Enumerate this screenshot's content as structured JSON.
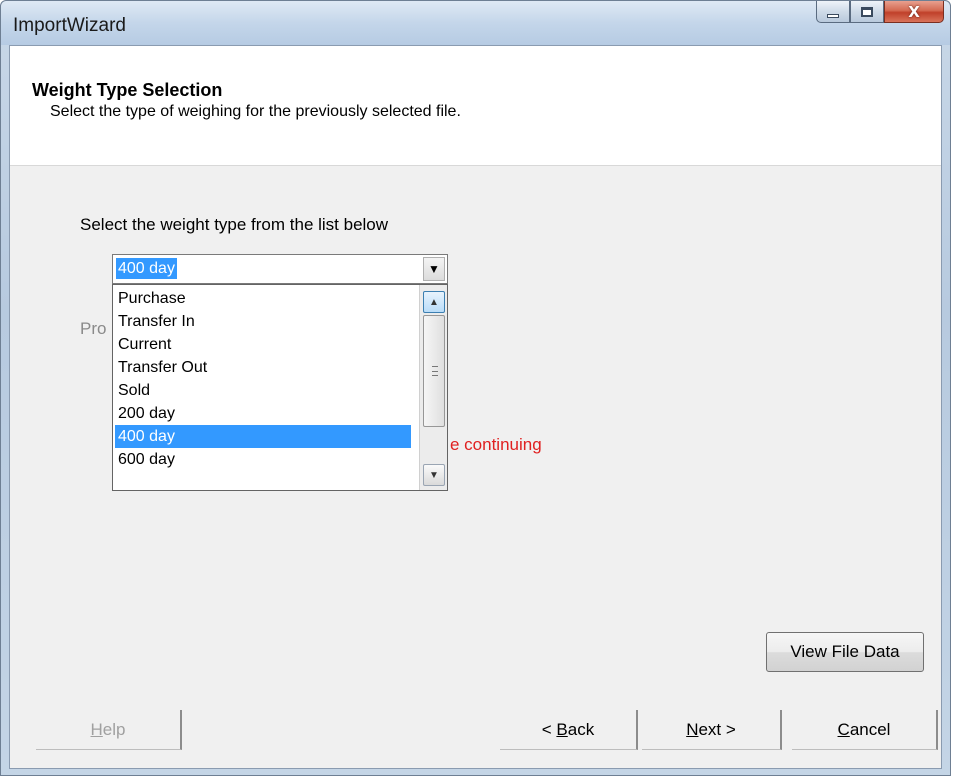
{
  "window": {
    "title": "ImportWizard",
    "minimize_icon": "minimize-icon",
    "maximize_icon": "maximize-icon",
    "close_icon": "close-icon",
    "close_glyph": "X"
  },
  "header": {
    "title": "Weight Type Selection",
    "subtitle": "Select the type of weighing for the previously selected file."
  },
  "form": {
    "prompt": "Select the weight type from the list below",
    "obscured_label": "Pro",
    "obscured_warning": "e continuing"
  },
  "weight_type": {
    "selected": "400 day",
    "arrow_icon": "chevron-down-icon",
    "options": [
      {
        "label": "Purchase",
        "selected": false
      },
      {
        "label": "Transfer In",
        "selected": false
      },
      {
        "label": "Current",
        "selected": false
      },
      {
        "label": "Transfer Out",
        "selected": false
      },
      {
        "label": "Sold",
        "selected": false
      },
      {
        "label": "200 day",
        "selected": false
      },
      {
        "label": "400 day",
        "selected": true
      },
      {
        "label": "600 day",
        "selected": false
      }
    ]
  },
  "buttons": {
    "view_file_data": "View File Data",
    "help_mnemonic": "H",
    "help_rest": "elp",
    "back_prefix": "< ",
    "back_mnemonic": "B",
    "back_rest": "ack",
    "next_mnemonic": "N",
    "next_rest": "ext >",
    "cancel_mnemonic": "C",
    "cancel_rest": "ancel"
  },
  "colors": {
    "selection": "#3399ff",
    "warning_text": "#e02020",
    "client_bg": "#f0f0f0"
  }
}
